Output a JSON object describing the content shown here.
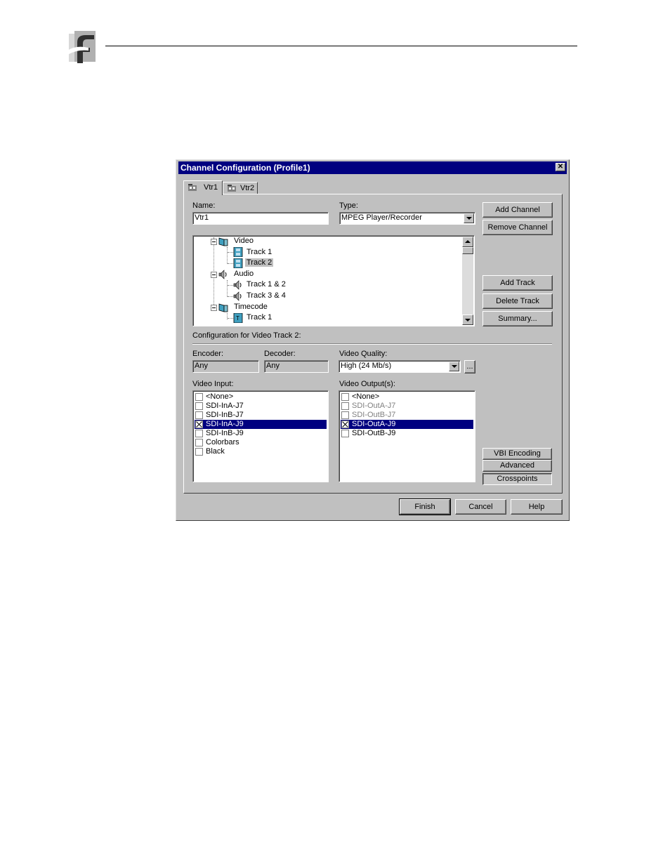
{
  "dialog": {
    "title": "Channel Configuration (Profile1)",
    "tabs": [
      {
        "label": "Vtr1"
      },
      {
        "label": "Vtr2"
      }
    ],
    "name": {
      "label": "Name:",
      "value": "Vtr1"
    },
    "type": {
      "label": "Type:",
      "value": "MPEG Player/Recorder"
    },
    "buttons": {
      "add_channel": "Add Channel",
      "remove_channel": "Remove Channel",
      "add_track": "Add Track",
      "delete_track": "Delete Track",
      "summary": "Summary...",
      "vbi_encoding": "VBI Encoding",
      "advanced": "Advanced",
      "crosspoints": "Crosspoints",
      "finish": "Finish",
      "cancel": "Cancel",
      "help": "Help",
      "ellipsis": "..."
    },
    "tree": {
      "video": "Video",
      "video_track1": "Track 1",
      "video_track2": "Track 2",
      "audio": "Audio",
      "audio_track12": "Track 1 & 2",
      "audio_track34": "Track 3 & 4",
      "timecode": "Timecode",
      "timecode_track1": "Track 1"
    },
    "config_label": "Configuration for Video Track 2:",
    "encoder": {
      "label": "Encoder:",
      "value": "Any"
    },
    "decoder": {
      "label": "Decoder:",
      "value": "Any"
    },
    "video_quality": {
      "label": "Video Quality:",
      "value": "High (24 Mb/s)"
    },
    "video_input": {
      "label": "Video Input:",
      "items": [
        {
          "label": "<None>",
          "checked": false,
          "selected": false,
          "disabled": false
        },
        {
          "label": "SDI-InA-J7",
          "checked": false,
          "selected": false,
          "disabled": false
        },
        {
          "label": "SDI-InB-J7",
          "checked": false,
          "selected": false,
          "disabled": false
        },
        {
          "label": "SDI-InA-J9",
          "checked": true,
          "selected": true,
          "disabled": false
        },
        {
          "label": "SDI-InB-J9",
          "checked": false,
          "selected": false,
          "disabled": false
        },
        {
          "label": "Colorbars",
          "checked": false,
          "selected": false,
          "disabled": false
        },
        {
          "label": "Black",
          "checked": false,
          "selected": false,
          "disabled": false
        }
      ]
    },
    "video_output": {
      "label": "Video Output(s):",
      "items": [
        {
          "label": "<None>",
          "checked": false,
          "selected": false,
          "disabled": false
        },
        {
          "label": "SDI-OutA-J7",
          "checked": false,
          "selected": false,
          "disabled": true
        },
        {
          "label": "SDI-OutB-J7",
          "checked": false,
          "selected": false,
          "disabled": true
        },
        {
          "label": "SDI-OutA-J9",
          "checked": true,
          "selected": true,
          "disabled": false
        },
        {
          "label": "SDI-OutB-J9",
          "checked": false,
          "selected": false,
          "disabled": false
        }
      ]
    }
  },
  "colors": {
    "titlebar": "#000080",
    "face": "#c0c0c0",
    "selection": "#000080"
  }
}
